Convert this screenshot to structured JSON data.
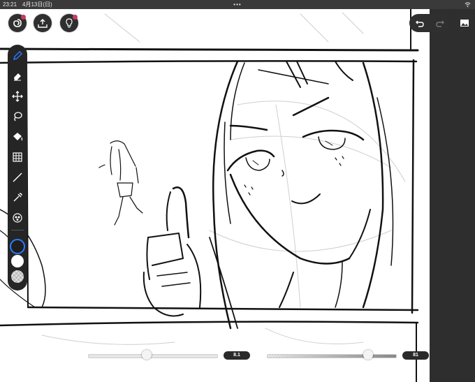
{
  "status_bar": {
    "time": "23:21",
    "date": "4月13日(日)",
    "dots": "•••"
  },
  "toolbar": {
    "tools": [
      {
        "name": "pen-icon",
        "active": true
      },
      {
        "name": "eraser-icon"
      },
      {
        "name": "move-icon"
      },
      {
        "name": "lasso-icon"
      },
      {
        "name": "fill-icon"
      },
      {
        "name": "grid-icon"
      },
      {
        "name": "line-icon"
      },
      {
        "name": "eyedropper-icon"
      },
      {
        "name": "tone-icon"
      }
    ],
    "colors": [
      "#1e1e1e",
      "#ffffff",
      "transparent"
    ]
  },
  "brush_size": {
    "label": "8.1",
    "fraction": 0.45
  },
  "brush_opacity": {
    "label": "81",
    "fraction": 0.81
  },
  "colors": {
    "accent": "#2b7bff",
    "badge": "#c73b5f"
  }
}
